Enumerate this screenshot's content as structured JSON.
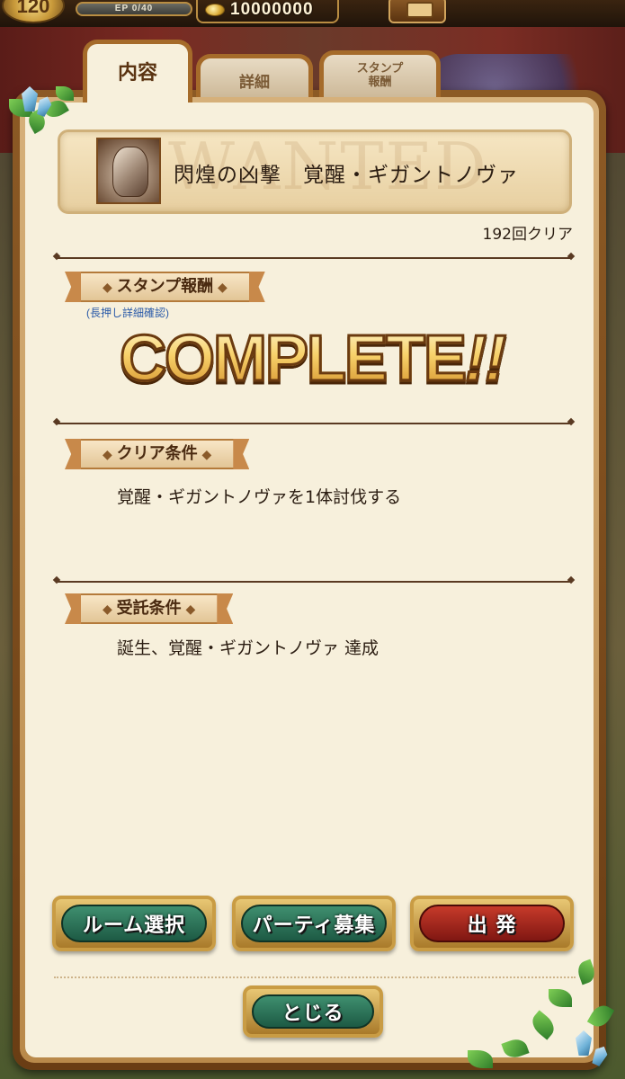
{
  "status": {
    "level": "120",
    "ep_label": "EP 0/40",
    "ep_progress": 0,
    "money": "10000000"
  },
  "tabs": [
    {
      "label": "内容",
      "active": true
    },
    {
      "label": "詳細",
      "active": false
    },
    {
      "label": "スタンプ\n報酬",
      "active": false
    }
  ],
  "quest": {
    "watermark": "WANTED",
    "title": "閃煌の凶撃　覚醒・ギガントノヴァ",
    "clear_count": "192回クリア"
  },
  "stamp_section": {
    "heading": "スタンプ報酬",
    "hint": "(長押し詳細確認)",
    "complete_main": "COMPLETE",
    "complete_excl": "!!"
  },
  "clear_section": {
    "heading": "クリア条件",
    "text": "覚醒・ギガントノヴァを1体討伐する"
  },
  "accept_section": {
    "heading": "受託条件",
    "text": "誕生、覚醒・ギガントノヴァ 達成"
  },
  "buttons": {
    "room": "ルーム選択",
    "party": "パーティ募集",
    "depart": "出 発",
    "close": "とじる"
  },
  "colors": {
    "paper": "#f7f0dc",
    "frame": "#8c5a25",
    "button_green": "#2a7055",
    "button_red": "#a52a1e",
    "hint_blue": "#2a5aa8"
  }
}
